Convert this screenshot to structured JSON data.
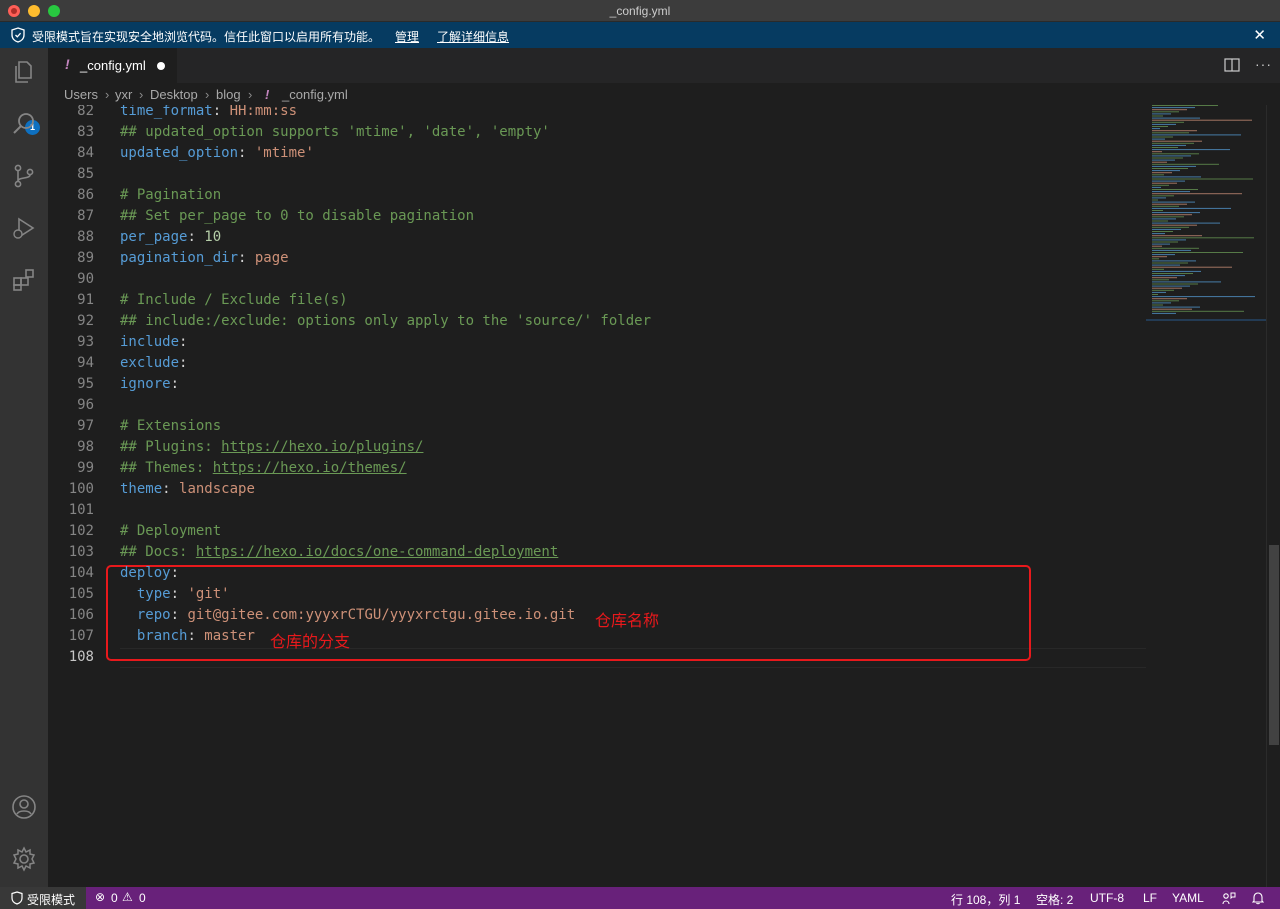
{
  "window": {
    "title": "_config.yml"
  },
  "banner": {
    "message": "受限模式旨在实现安全地浏览代码。信任此窗口以启用所有功能。",
    "manage_link": "管理",
    "learn_link": "了解详细信息",
    "close": "✕",
    "color": "#063b61"
  },
  "activity_bar": {
    "items": [
      "files-icon",
      "search-icon",
      "source-control-icon",
      "run-debug-icon",
      "extensions-icon",
      "account-icon",
      "gear-icon"
    ],
    "explorer_badge": "1"
  },
  "tab": {
    "icon": "!",
    "label": "_config.yml"
  },
  "breadcrumb": [
    "Users",
    "yxr",
    "Desktop",
    "blog",
    "_config.yml"
  ],
  "editor": {
    "lines": [
      {
        "n": "82",
        "parts": [
          [
            "k",
            "time_format"
          ],
          [
            "p",
            ": "
          ],
          [
            "s",
            "HH:mm:ss"
          ]
        ]
      },
      {
        "n": "83",
        "parts": [
          [
            "c",
            "## updated_option supports 'mtime', 'date', 'empty'"
          ]
        ]
      },
      {
        "n": "84",
        "parts": [
          [
            "k",
            "updated_option"
          ],
          [
            "p",
            ": "
          ],
          [
            "s",
            "'mtime'"
          ]
        ]
      },
      {
        "n": "85",
        "parts": []
      },
      {
        "n": "86",
        "parts": [
          [
            "c",
            "# Pagination"
          ]
        ]
      },
      {
        "n": "87",
        "parts": [
          [
            "c",
            "## Set per_page to 0 to disable pagination"
          ]
        ]
      },
      {
        "n": "88",
        "parts": [
          [
            "k",
            "per_page"
          ],
          [
            "p",
            ": "
          ],
          [
            "n",
            "10"
          ]
        ]
      },
      {
        "n": "89",
        "parts": [
          [
            "k",
            "pagination_dir"
          ],
          [
            "p",
            ": "
          ],
          [
            "s",
            "page"
          ]
        ]
      },
      {
        "n": "90",
        "parts": []
      },
      {
        "n": "91",
        "parts": [
          [
            "c",
            "# Include / Exclude file(s)"
          ]
        ]
      },
      {
        "n": "92",
        "parts": [
          [
            "c",
            "## include:/exclude: options only apply to the 'source/' folder"
          ]
        ]
      },
      {
        "n": "93",
        "parts": [
          [
            "k",
            "include"
          ],
          [
            "p",
            ":"
          ]
        ]
      },
      {
        "n": "94",
        "parts": [
          [
            "k",
            "exclude"
          ],
          [
            "p",
            ":"
          ]
        ]
      },
      {
        "n": "95",
        "parts": [
          [
            "k",
            "ignore"
          ],
          [
            "p",
            ":"
          ]
        ]
      },
      {
        "n": "96",
        "parts": []
      },
      {
        "n": "97",
        "parts": [
          [
            "c",
            "# Extensions"
          ]
        ]
      },
      {
        "n": "98",
        "parts": [
          [
            "c",
            "## Plugins: "
          ],
          [
            "cu",
            "https://hexo.io/plugins/"
          ]
        ]
      },
      {
        "n": "99",
        "parts": [
          [
            "c",
            "## Themes: "
          ],
          [
            "cu",
            "https://hexo.io/themes/"
          ]
        ]
      },
      {
        "n": "100",
        "parts": [
          [
            "k",
            "theme"
          ],
          [
            "p",
            ": "
          ],
          [
            "s",
            "landscape"
          ]
        ]
      },
      {
        "n": "101",
        "parts": []
      },
      {
        "n": "102",
        "parts": [
          [
            "c",
            "# Deployment"
          ]
        ]
      },
      {
        "n": "103",
        "parts": [
          [
            "c",
            "## Docs: "
          ],
          [
            "cu",
            "https://hexo.io/docs/one-command-deployment"
          ]
        ]
      },
      {
        "n": "104",
        "parts": [
          [
            "k",
            "deploy"
          ],
          [
            "p",
            ":"
          ]
        ]
      },
      {
        "n": "105",
        "parts": [
          [
            "p",
            "  "
          ],
          [
            "k",
            "type"
          ],
          [
            "p",
            ": "
          ],
          [
            "s",
            "'git'"
          ]
        ]
      },
      {
        "n": "106",
        "parts": [
          [
            "p",
            "  "
          ],
          [
            "k",
            "repo"
          ],
          [
            "p",
            ": "
          ],
          [
            "s",
            "git@gitee.com:yyyxrCTGU/yyyxrctgu.gitee.io.git"
          ]
        ]
      },
      {
        "n": "107",
        "parts": [
          [
            "p",
            "  "
          ],
          [
            "k",
            "branch"
          ],
          [
            "p",
            ": "
          ],
          [
            "s",
            "master"
          ]
        ]
      },
      {
        "n": "108",
        "parts": []
      }
    ],
    "annotations": {
      "repo_note": "仓库名称",
      "branch_note": "仓库的分支"
    }
  },
  "statusbar": {
    "mode": "受限模式",
    "errors": "0",
    "warnings": "0",
    "position": "行 108，列 1",
    "spaces": "空格: 2",
    "encoding": "UTF-8",
    "eol": "LF",
    "language": "YAML",
    "color": "#68217a"
  }
}
